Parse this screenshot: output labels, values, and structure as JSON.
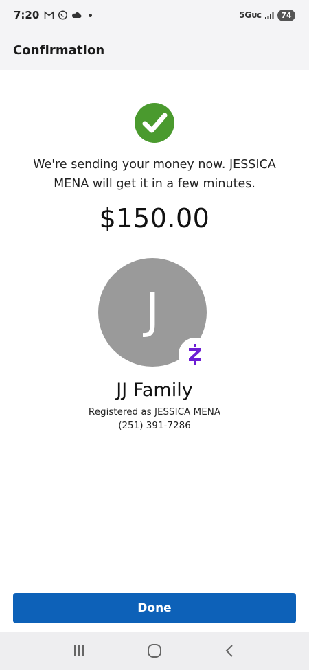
{
  "status_bar": {
    "time": "7:20",
    "network": "5Gᴜᴄ",
    "battery": "74",
    "icons": [
      "gmail-icon",
      "whatsapp-icon",
      "cloud-icon",
      "notification-dot-icon",
      "signal-icon"
    ]
  },
  "header": {
    "title": "Confirmation"
  },
  "confirmation": {
    "message": "We're sending your money now. JESSICA MENA will get it in a few minutes.",
    "amount": "$150.00",
    "success_icon": "check-circle-icon",
    "success_color": "#4a9a2e"
  },
  "recipient": {
    "initial": "J",
    "name": "JJ Family",
    "registered_as": "Registered as JESSICA MENA",
    "phone": "(251) 391-7286",
    "badge_icon": "zelle-icon",
    "badge_color": "#6d1ed4",
    "avatar_color": "#9a9a9a"
  },
  "actions": {
    "done_label": "Done",
    "button_color": "#0d61b8"
  },
  "nav": {
    "icons": [
      "recent-apps-icon",
      "home-icon",
      "back-icon"
    ]
  }
}
